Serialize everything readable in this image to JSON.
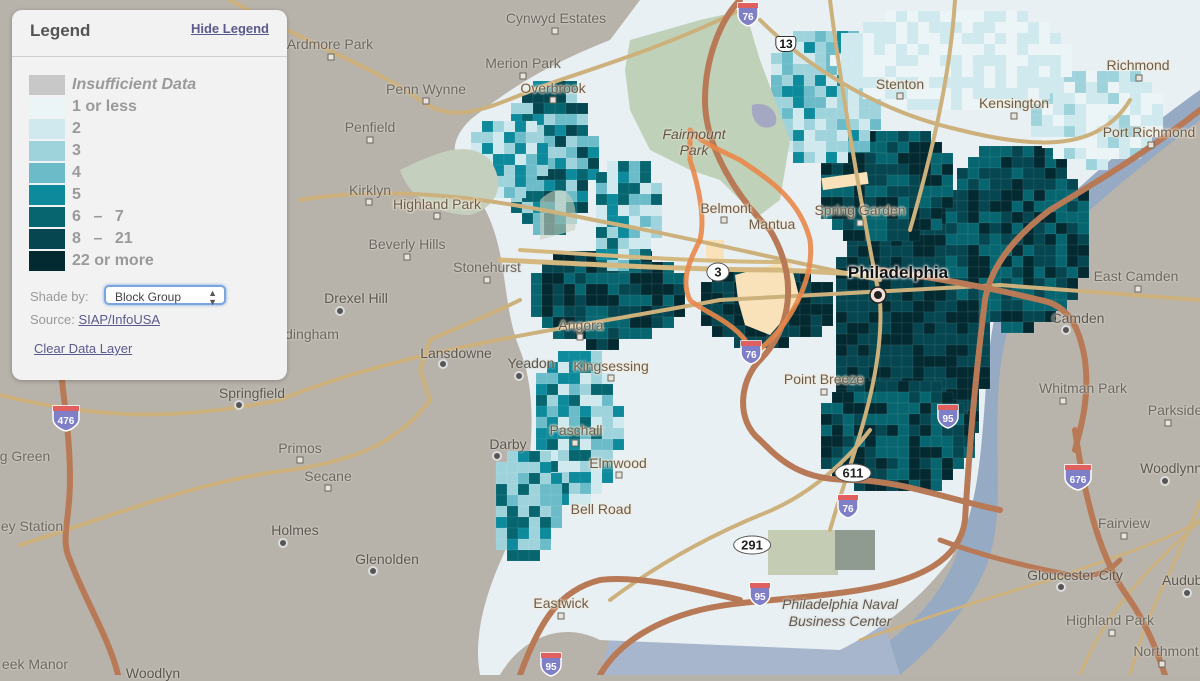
{
  "legend": {
    "title": "Legend",
    "hide_label": "Hide Legend",
    "classes": [
      {
        "label": "Insufficient Data",
        "color": "#c8c8c8",
        "italic": true
      },
      {
        "label": "1 or less",
        "color": "#ebf4f6"
      },
      {
        "label": "2",
        "color": "#cfe9ee"
      },
      {
        "label": "3",
        "color": "#9fd3dc"
      },
      {
        "label": "4",
        "color": "#6bbcc8"
      },
      {
        "label": "5",
        "color": "#0d8a9c"
      },
      {
        "label_from": "6",
        "label_to": "7",
        "color": "#07656f"
      },
      {
        "label_from": "8",
        "label_to": "21",
        "color": "#064650"
      },
      {
        "label": "22 or more",
        "color": "#042a31"
      }
    ],
    "range_dash": "–",
    "shade_by_label": "Shade by:",
    "shade_by_value": "Block Group",
    "source_label": "Source:",
    "source_link": "SIAP/InfoUSA",
    "clear_label": "Clear Data Layer"
  },
  "map": {
    "colors": {
      "land": "#b7b2aa",
      "water": "#9fb5cd",
      "park": "#bfcdb6",
      "highway": "#b97b57",
      "arterial": "#d4b57f",
      "route_highlight": "#e9874a"
    },
    "places": [
      {
        "name": "Cynwyd Estates",
        "type": "suburb"
      },
      {
        "name": "Ardmore Park",
        "type": "suburb"
      },
      {
        "name": "Merion Park",
        "type": "suburb"
      },
      {
        "name": "Penn Wynne",
        "type": "suburb"
      },
      {
        "name": "Overbrook",
        "type": "neighborhood"
      },
      {
        "name": "Penfield",
        "type": "suburb"
      },
      {
        "name": "Kirklyn",
        "type": "suburb"
      },
      {
        "name": "Highland Park",
        "type": "suburb"
      },
      {
        "name": "Beverly Hills",
        "type": "suburb"
      },
      {
        "name": "Stonehurst",
        "type": "suburb"
      },
      {
        "name": "Drexel Hill",
        "type": "town"
      },
      {
        "name": "dingham",
        "type": "suburb"
      },
      {
        "name": "Lansdowne",
        "type": "town"
      },
      {
        "name": "Yeadon",
        "type": "town"
      },
      {
        "name": "Springfield",
        "type": "town"
      },
      {
        "name": "g Green",
        "type": "suburb"
      },
      {
        "name": "Primos",
        "type": "suburb"
      },
      {
        "name": "Secane",
        "type": "suburb"
      },
      {
        "name": "Darby",
        "type": "town"
      },
      {
        "name": "ey Station",
        "type": "suburb"
      },
      {
        "name": "Holmes",
        "type": "town"
      },
      {
        "name": "Glenolden",
        "type": "town"
      },
      {
        "name": "eek Manor",
        "type": "suburb"
      },
      {
        "name": "Woodlyn",
        "type": "suburb"
      },
      {
        "name": "Fairmount Park",
        "type": "park"
      },
      {
        "name": "Stenton",
        "type": "neighborhood"
      },
      {
        "name": "Richmond",
        "type": "neighborhood"
      },
      {
        "name": "Kensington",
        "type": "neighborhood"
      },
      {
        "name": "Port Richmond",
        "type": "neighborhood"
      },
      {
        "name": "Belmont",
        "type": "neighborhood"
      },
      {
        "name": "Mantua",
        "type": "neighborhood"
      },
      {
        "name": "Spring Garden",
        "type": "neighborhood"
      },
      {
        "name": "Philadelphia",
        "type": "major-city"
      },
      {
        "name": "Angora",
        "type": "neighborhood"
      },
      {
        "name": "Kingsessing",
        "type": "neighborhood"
      },
      {
        "name": "Paschall",
        "type": "neighborhood"
      },
      {
        "name": "Elmwood",
        "type": "neighborhood"
      },
      {
        "name": "Bell Road",
        "type": "neighborhood"
      },
      {
        "name": "Eastwick",
        "type": "neighborhood"
      },
      {
        "name": "Point Breeze",
        "type": "neighborhood"
      },
      {
        "name": "Philadelphia Naval Business Center",
        "type": "facility"
      },
      {
        "name": "East Camden",
        "type": "suburb"
      },
      {
        "name": "Camden",
        "type": "city"
      },
      {
        "name": "Whitman Park",
        "type": "suburb"
      },
      {
        "name": "Parkside",
        "type": "suburb"
      },
      {
        "name": "Woodlynne",
        "type": "town"
      },
      {
        "name": "Fairview",
        "type": "suburb"
      },
      {
        "name": "Gloucester City",
        "type": "town"
      },
      {
        "name": "Audubon",
        "type": "town"
      },
      {
        "name": "Highland Park",
        "type": "suburb"
      },
      {
        "name": "Northmont",
        "type": "suburb"
      }
    ],
    "routes": {
      "interstates": [
        "76",
        "76",
        "76",
        "95",
        "95",
        "476",
        "676"
      ],
      "us_routes": [
        "13"
      ],
      "state_routes": [
        "3",
        "611",
        "291"
      ]
    }
  }
}
